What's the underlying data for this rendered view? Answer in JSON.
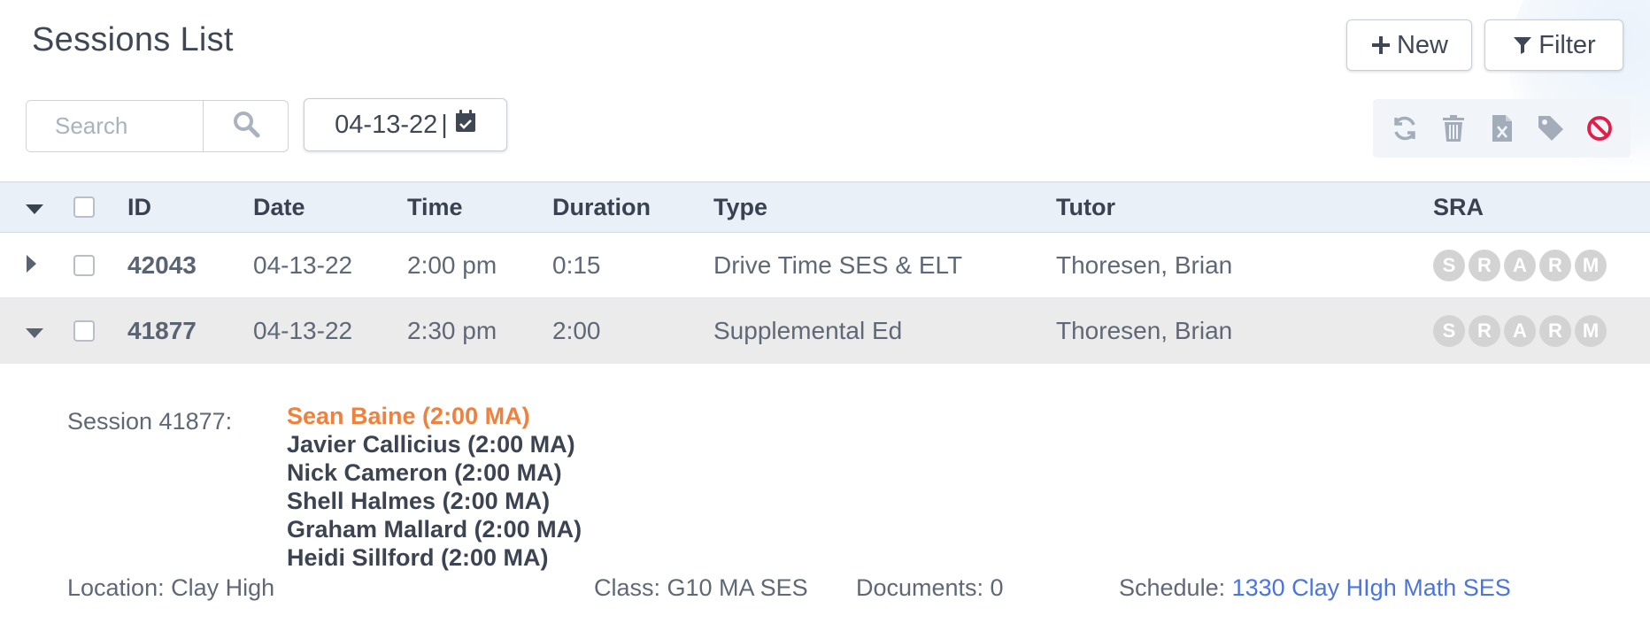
{
  "header": {
    "title": "Sessions List",
    "new_label": "New",
    "filter_label": "Filter"
  },
  "search": {
    "placeholder": "Search",
    "value": ""
  },
  "date_picker": {
    "value": "04-13-22",
    "separator": "|"
  },
  "toolbar": {
    "icons": [
      "refresh-icon",
      "trash-icon",
      "excel-file-icon",
      "tag-icon",
      "cancel-icon"
    ],
    "cancel_color": "#e11d48"
  },
  "table": {
    "columns": [
      "ID",
      "Date",
      "Time",
      "Duration",
      "Type",
      "Tutor",
      "SRA"
    ],
    "rows": [
      {
        "id": "42043",
        "date": "04-13-22",
        "time": "2:00 pm",
        "duration": "0:15",
        "type": "Drive Time SES & ELT",
        "tutor": "Thoresen, Brian",
        "expanded": false
      },
      {
        "id": "41877",
        "date": "04-13-22",
        "time": "2:30 pm",
        "duration": "2:00",
        "type": "Supplemental Ed",
        "tutor": "Thoresen, Brian",
        "expanded": true
      }
    ],
    "sra_badges": [
      "S",
      "R",
      "A",
      "R",
      "M"
    ]
  },
  "detail": {
    "label": "Session 41877:",
    "students": [
      "Sean Baine (2:00 MA)",
      "Javier Callicius (2:00 MA)",
      "Nick Cameron (2:00 MA)",
      "Shell Halmes (2:00 MA)",
      "Graham Mallard (2:00 MA)",
      "Heidi Sillford (2:00 MA)"
    ],
    "location": "Location: Clay High",
    "class": "Class: G10 MA SES",
    "documents": "Documents: 0",
    "schedule_label": "Schedule: ",
    "schedule_link": "1330 Clay HIgh Math SES"
  },
  "colors": {
    "accent_orange": "#f0813c",
    "link_blue": "#4a74e0",
    "header_bg": "#eaf0f8",
    "expanded_row_bg": "#ebebeb"
  }
}
